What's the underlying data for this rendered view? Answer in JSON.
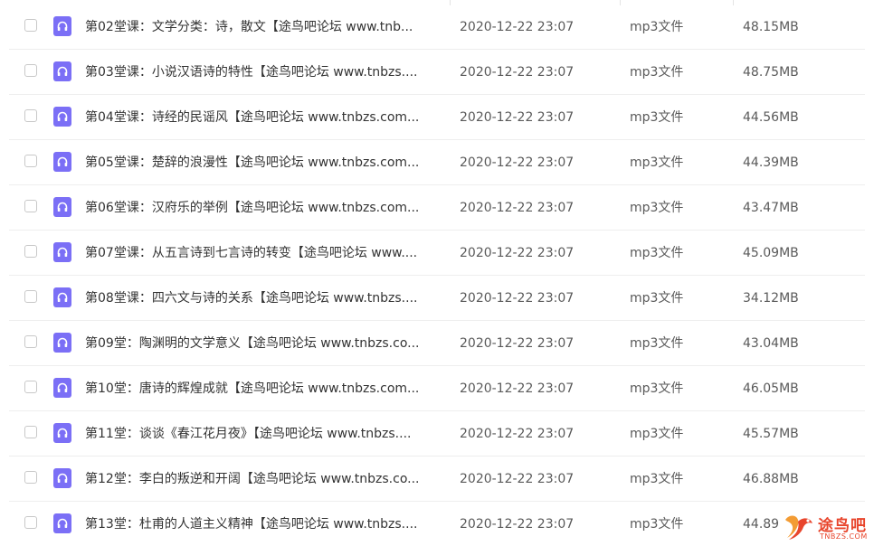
{
  "files": [
    {
      "name": "第02堂课：文学分类：诗，散文【途鸟吧论坛 www.tnb...",
      "date": "2020-12-22 23:07",
      "type": "mp3文件",
      "size": "48.15MB"
    },
    {
      "name": "第03堂课：小说汉语诗的特性【途鸟吧论坛 www.tnbzs....",
      "date": "2020-12-22 23:07",
      "type": "mp3文件",
      "size": "48.75MB"
    },
    {
      "name": "第04堂课：诗经的民谣风【途鸟吧论坛 www.tnbzs.com...",
      "date": "2020-12-22 23:07",
      "type": "mp3文件",
      "size": "44.56MB"
    },
    {
      "name": "第05堂课：楚辞的浪漫性【途鸟吧论坛 www.tnbzs.com...",
      "date": "2020-12-22 23:07",
      "type": "mp3文件",
      "size": "44.39MB"
    },
    {
      "name": "第06堂课：汉府乐的举例【途鸟吧论坛 www.tnbzs.com...",
      "date": "2020-12-22 23:07",
      "type": "mp3文件",
      "size": "43.47MB"
    },
    {
      "name": "第07堂课：从五言诗到七言诗的转变【途鸟吧论坛 www....",
      "date": "2020-12-22 23:07",
      "type": "mp3文件",
      "size": "45.09MB"
    },
    {
      "name": "第08堂课：四六文与诗的关系【途鸟吧论坛 www.tnbzs....",
      "date": "2020-12-22 23:07",
      "type": "mp3文件",
      "size": "34.12MB"
    },
    {
      "name": "第09堂：陶渊明的文学意义【途鸟吧论坛 www.tnbzs.co...",
      "date": "2020-12-22 23:07",
      "type": "mp3文件",
      "size": "43.04MB"
    },
    {
      "name": "第10堂：唐诗的辉煌成就【途鸟吧论坛 www.tnbzs.com...",
      "date": "2020-12-22 23:07",
      "type": "mp3文件",
      "size": "46.05MB"
    },
    {
      "name": "第11堂：谈谈《春江花月夜》【途鸟吧论坛 www.tnbzs....",
      "date": "2020-12-22 23:07",
      "type": "mp3文件",
      "size": "45.57MB"
    },
    {
      "name": "第12堂：李白的叛逆和开阔【途鸟吧论坛 www.tnbzs.co...",
      "date": "2020-12-22 23:07",
      "type": "mp3文件",
      "size": "46.88MB"
    },
    {
      "name": "第13堂：杜甫的人道主义精神【途鸟吧论坛 www.tnbzs....",
      "date": "2020-12-22 23:07",
      "type": "mp3文件",
      "size": "44.89"
    }
  ],
  "file_icon": "audio-file-icon",
  "accent_color": "#7b6ff6",
  "watermark": {
    "text": "途鸟吧",
    "domain": "TNBZS.COM",
    "color": "#e8452c"
  }
}
